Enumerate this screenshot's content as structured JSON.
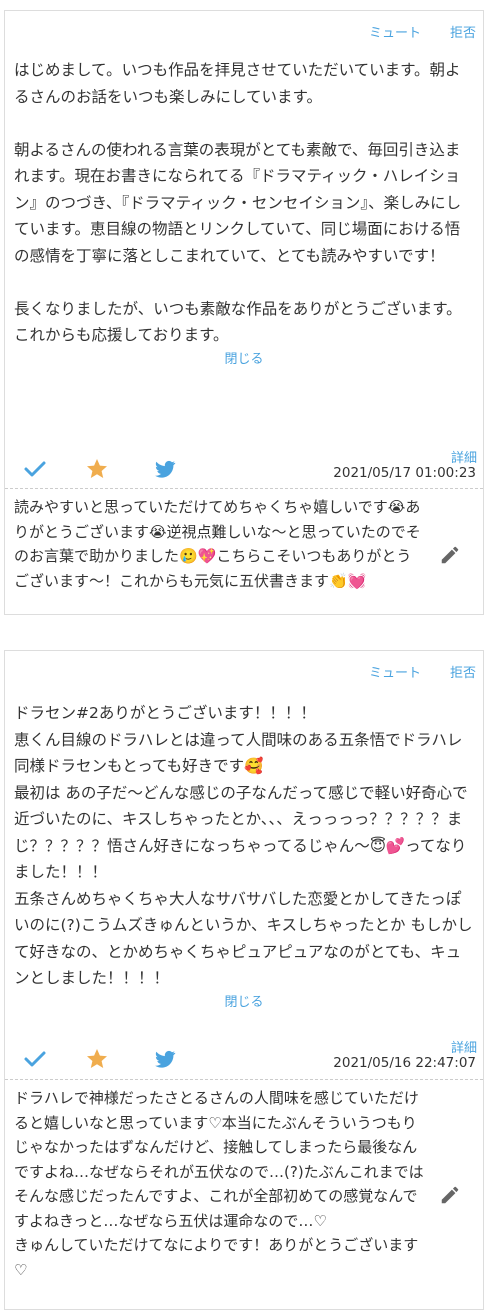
{
  "colors": {
    "accent": "#4aa3df",
    "star": "#f0ad4e",
    "text": "#333333",
    "border": "#dddddd"
  },
  "comments": [
    {
      "mute_label": "ミュート",
      "reject_label": "拒否",
      "body": "はじめまして。いつも作品を拝見させていただいています。朝よるさんのお話をいつも楽しみにしています。\n\n朝よるさんの使われる言葉の表現がとても素敵で、毎回引き込まれます。現在お書きになられてる『ドラマティック・ハレイション』のつづき、『ドラマティック・センセイション』、楽しみにしています。恵目線の物語とリンクしていて、同じ場面における悟の感情を丁寧に落としこまれていて、とても読みやすいです！\n\n長くなりましたが、いつも素敵な作品をありがとうございます。\nこれからも応援しております。",
      "close_label": "閉じる",
      "details_label": "詳細",
      "timestamp": "2021/05/17 01:00:23",
      "icons": [
        "check-icon",
        "star-icon",
        "twitter-icon"
      ],
      "reply": "読みやすいと思っていただけてめちゃくちゃ嬉しいです😭ありがとうございます😭逆視点難しいな〜と思っていたのでそのお言葉で助かりました🥲💖こちらこそいつもありがとうございます〜！これからも元気に五伏書きます👏💓"
    },
    {
      "mute_label": "ミュート",
      "reject_label": "拒否",
      "body": "ドラセン#2ありがとうございます！！！！\n恵くん目線のドラハレとは違って人間味のある五条悟でドラハレ同様ドラセンもとっても好きです🥰\n最初は あの子だ〜どんな感じの子なんだって感じで軽い好奇心で近づいたのに、キスしちゃったとか、、、えっっっっ？？？？？まじ？？？？？悟さん好きになっちゃってるじゃん〜😇💕ってなりました！！！\n五条さんめちゃくちゃ大人なサバサバした恋愛とかしてきたっぽいのに(?)こうムズきゅんというか、キスしちゃったとか もしかして好きなの、とかめちゃくちゃピュアピュアなのがとても、キュンとしました！！！！",
      "close_label": "閉じる",
      "details_label": "詳細",
      "timestamp": "2021/05/16 22:47:07",
      "icons": [
        "check-icon",
        "star-icon",
        "twitter-icon"
      ],
      "reply": "ドラハレで神様だったさとるさんの人間味を感じていただけると嬉しいなと思っています♡本当にたぶんそういうつもりじゃなかったはずなんだけど、接触してしまったら最後なんですよね…なぜならそれが五伏なので…(?)たぶんこれまではそんな感じだったんですよ、これが全部初めての感覚なんですよねきっと…なぜなら五伏は運命なので…♡\nきゅんしていただけてなによりです！ありがとうございます♡"
    }
  ]
}
